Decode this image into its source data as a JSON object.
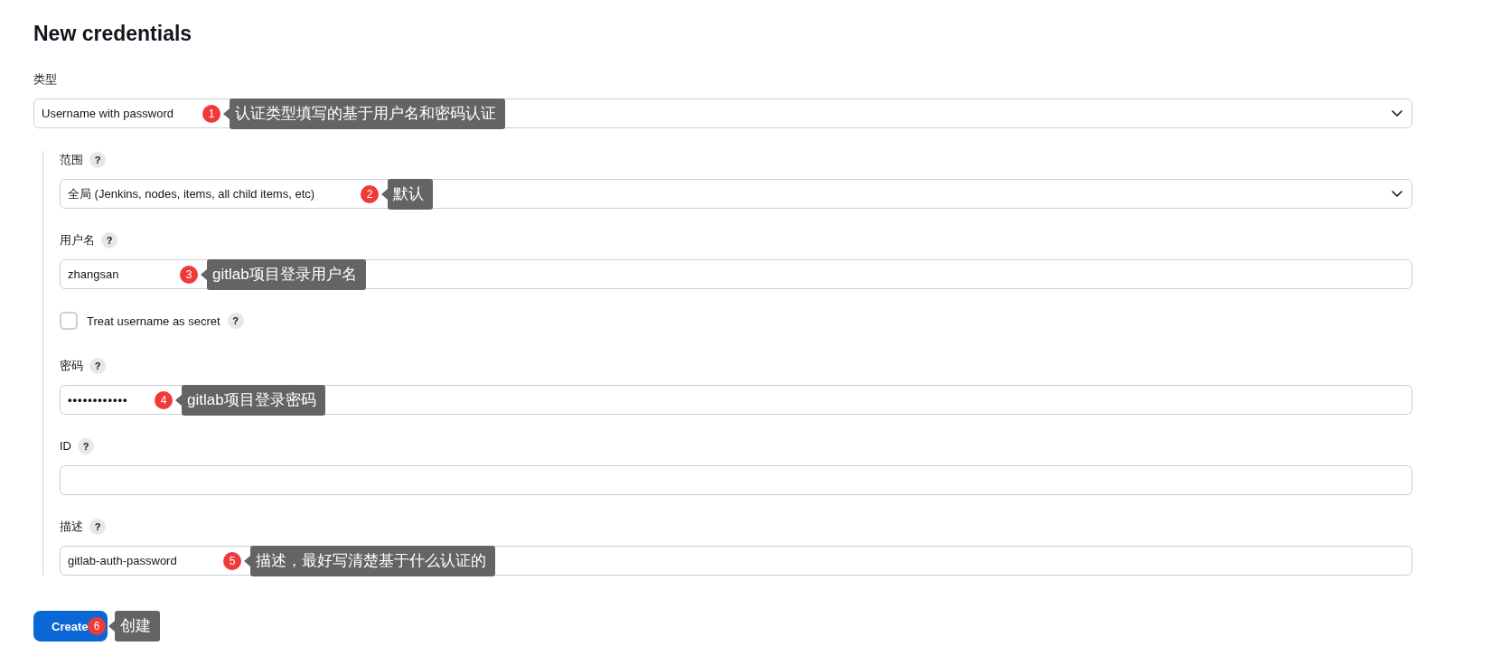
{
  "page": {
    "title": "New credentials"
  },
  "type_field": {
    "label": "类型",
    "value": "Username with password",
    "annotation": {
      "number": "1",
      "text": "认证类型填写的基于用户名和密码认证"
    }
  },
  "fields": [
    {
      "kind": "select",
      "label": "范围",
      "help": "?",
      "value": "全局 (Jenkins, nodes, items, all child items, etc)",
      "annotation": {
        "number": "2",
        "text": "默认"
      }
    },
    {
      "kind": "text",
      "label": "用户名",
      "help": "?",
      "value": "zhangsan",
      "annotation": {
        "number": "3",
        "text": "gitlab项目登录用户名"
      }
    },
    {
      "kind": "checkbox",
      "label": "Treat username as secret",
      "help": "?",
      "checked": false
    },
    {
      "kind": "password",
      "label": "密码",
      "help": "?",
      "value": "••••••••••••",
      "annotation": {
        "number": "4",
        "text": "gitlab项目登录密码"
      }
    },
    {
      "kind": "text",
      "label": "ID",
      "help": "?"
    },
    {
      "kind": "text",
      "label": "描述",
      "help": "?",
      "value": "gitlab-auth-password",
      "annotation": {
        "number": "5",
        "text": "描述，最好写清楚基于什么认证的"
      }
    }
  ],
  "create_button": {
    "label": "Create",
    "annotation": {
      "number": "6",
      "text": "创建"
    }
  }
}
